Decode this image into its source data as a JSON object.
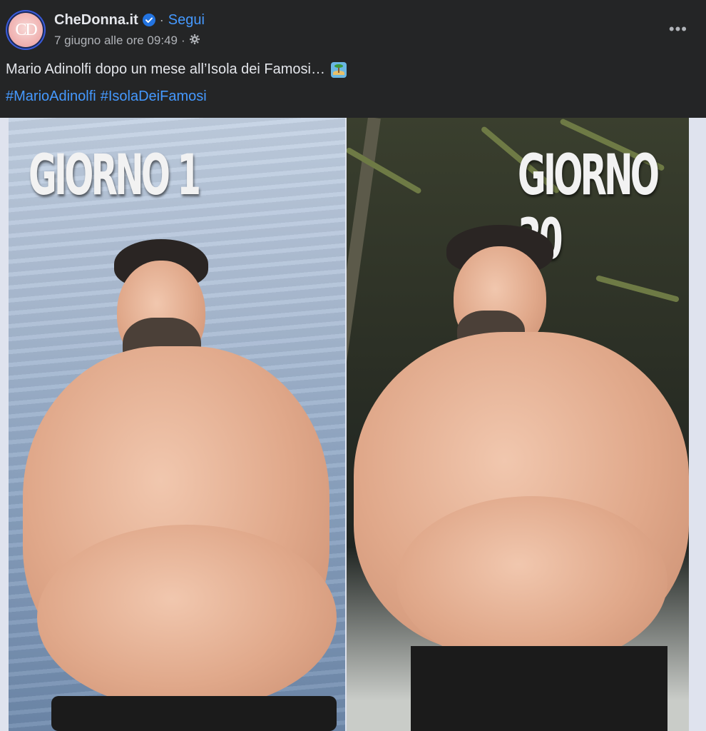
{
  "post": {
    "page_name": "CheDonna.it",
    "separator": "·",
    "follow_label": "Segui",
    "timestamp": "7 giugno alle ore 09:49",
    "meta_separator": "·",
    "avatar_text": "CD",
    "more_label": "•••",
    "caption": "Mario Adinolfi dopo un mese all’Isola dei Famosi…",
    "hashtags": [
      "#MarioAdinolfi",
      "#IsolaDeiFamosi"
    ]
  },
  "image": {
    "left_label": "GIORNO 1",
    "right_label": "GIORNO 30"
  },
  "colors": {
    "background": "#242526",
    "link": "#4599ff",
    "text": "#e4e6eb",
    "secondary_text": "#b0b3b8",
    "verified": "#2374e1"
  },
  "icons": {
    "verified": "verified-badge-icon",
    "privacy": "gear-icon",
    "caption_emoji": "desert-island-icon",
    "more": "more-horizontal-icon"
  }
}
